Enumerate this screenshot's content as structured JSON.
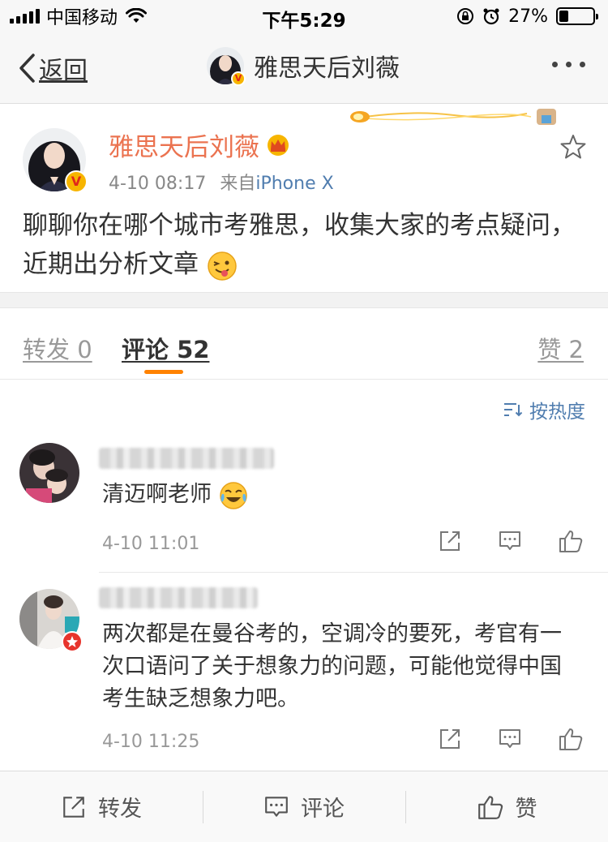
{
  "status_bar": {
    "carrier": "中国移动",
    "time": "下午5:29",
    "battery": "27%",
    "battery_level": 0.27
  },
  "nav": {
    "back_label": "返回",
    "title": "雅思天后刘薇",
    "more_icon": "more-dots-icon"
  },
  "post": {
    "author": "雅思天后刘薇",
    "date": "4-10 08:17",
    "source_prefix": "来自",
    "source": "iPhone X",
    "text": "聊聊你在哪个城市考雅思，收集大家的考点疑问，近期出分析文章"
  },
  "tabs": {
    "repost": "转发 0",
    "comment": "评论 52",
    "like": "赞 2"
  },
  "sort_label": "按热度",
  "comments": [
    {
      "text": "清迈啊老师",
      "time": "4-10 11:01"
    },
    {
      "text": "两次都是在曼谷考的，空调冷的要死，考官有一次口语问了关于想象力的问题，可能他觉得中国考生缺乏想象力吧。",
      "time": "4-10 11:25"
    }
  ],
  "toolbar": {
    "repost": "转发",
    "comment": "评论",
    "like": "赞"
  },
  "colors": {
    "accent_orange": "#ff8200",
    "author_orange": "#eb7350",
    "link_blue": "#507daf"
  }
}
